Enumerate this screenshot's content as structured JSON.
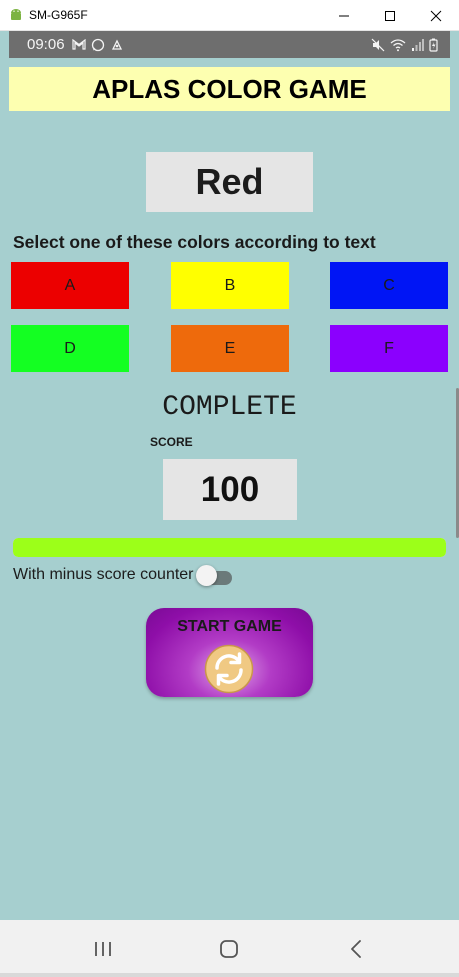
{
  "window": {
    "title": "SM-G965F"
  },
  "statusbar": {
    "time": "09:06"
  },
  "app": {
    "title": "APLAS COLOR GAME",
    "word": "Red",
    "instruction": "Select one of these colors according to text",
    "color_buttons": [
      {
        "label": "A",
        "color": "#ec0000"
      },
      {
        "label": "B",
        "color": "#ffff00"
      },
      {
        "label": "C",
        "color": "#0015f5"
      },
      {
        "label": "D",
        "color": "#14ff22"
      },
      {
        "label": "E",
        "color": "#ee6a0c"
      },
      {
        "label": "F",
        "color": "#8b00fe"
      }
    ],
    "status": "COMPLETE",
    "score_label": "SCORE",
    "score": "100",
    "progress": 1.0,
    "minus_counter_label": "With minus score counter",
    "minus_counter_on": false,
    "start_label": "START GAME",
    "accent_colors": {
      "title_bg": "#fdffb0",
      "background": "#a6cfcf",
      "progress": "#9cff19",
      "start_button": "#8e0ea8"
    }
  },
  "icons": {
    "window": [
      "android-icon",
      "minimize-icon",
      "maximize-icon",
      "close-icon"
    ],
    "status_left": [
      "gmail-icon",
      "whatsapp-icon",
      "cleaner-icon"
    ],
    "status_right": [
      "mute-icon",
      "wifi-icon",
      "signal-icon",
      "battery-icon"
    ],
    "nav": [
      "recents-icon",
      "home-icon",
      "back-icon"
    ],
    "start": "refresh-icon"
  }
}
